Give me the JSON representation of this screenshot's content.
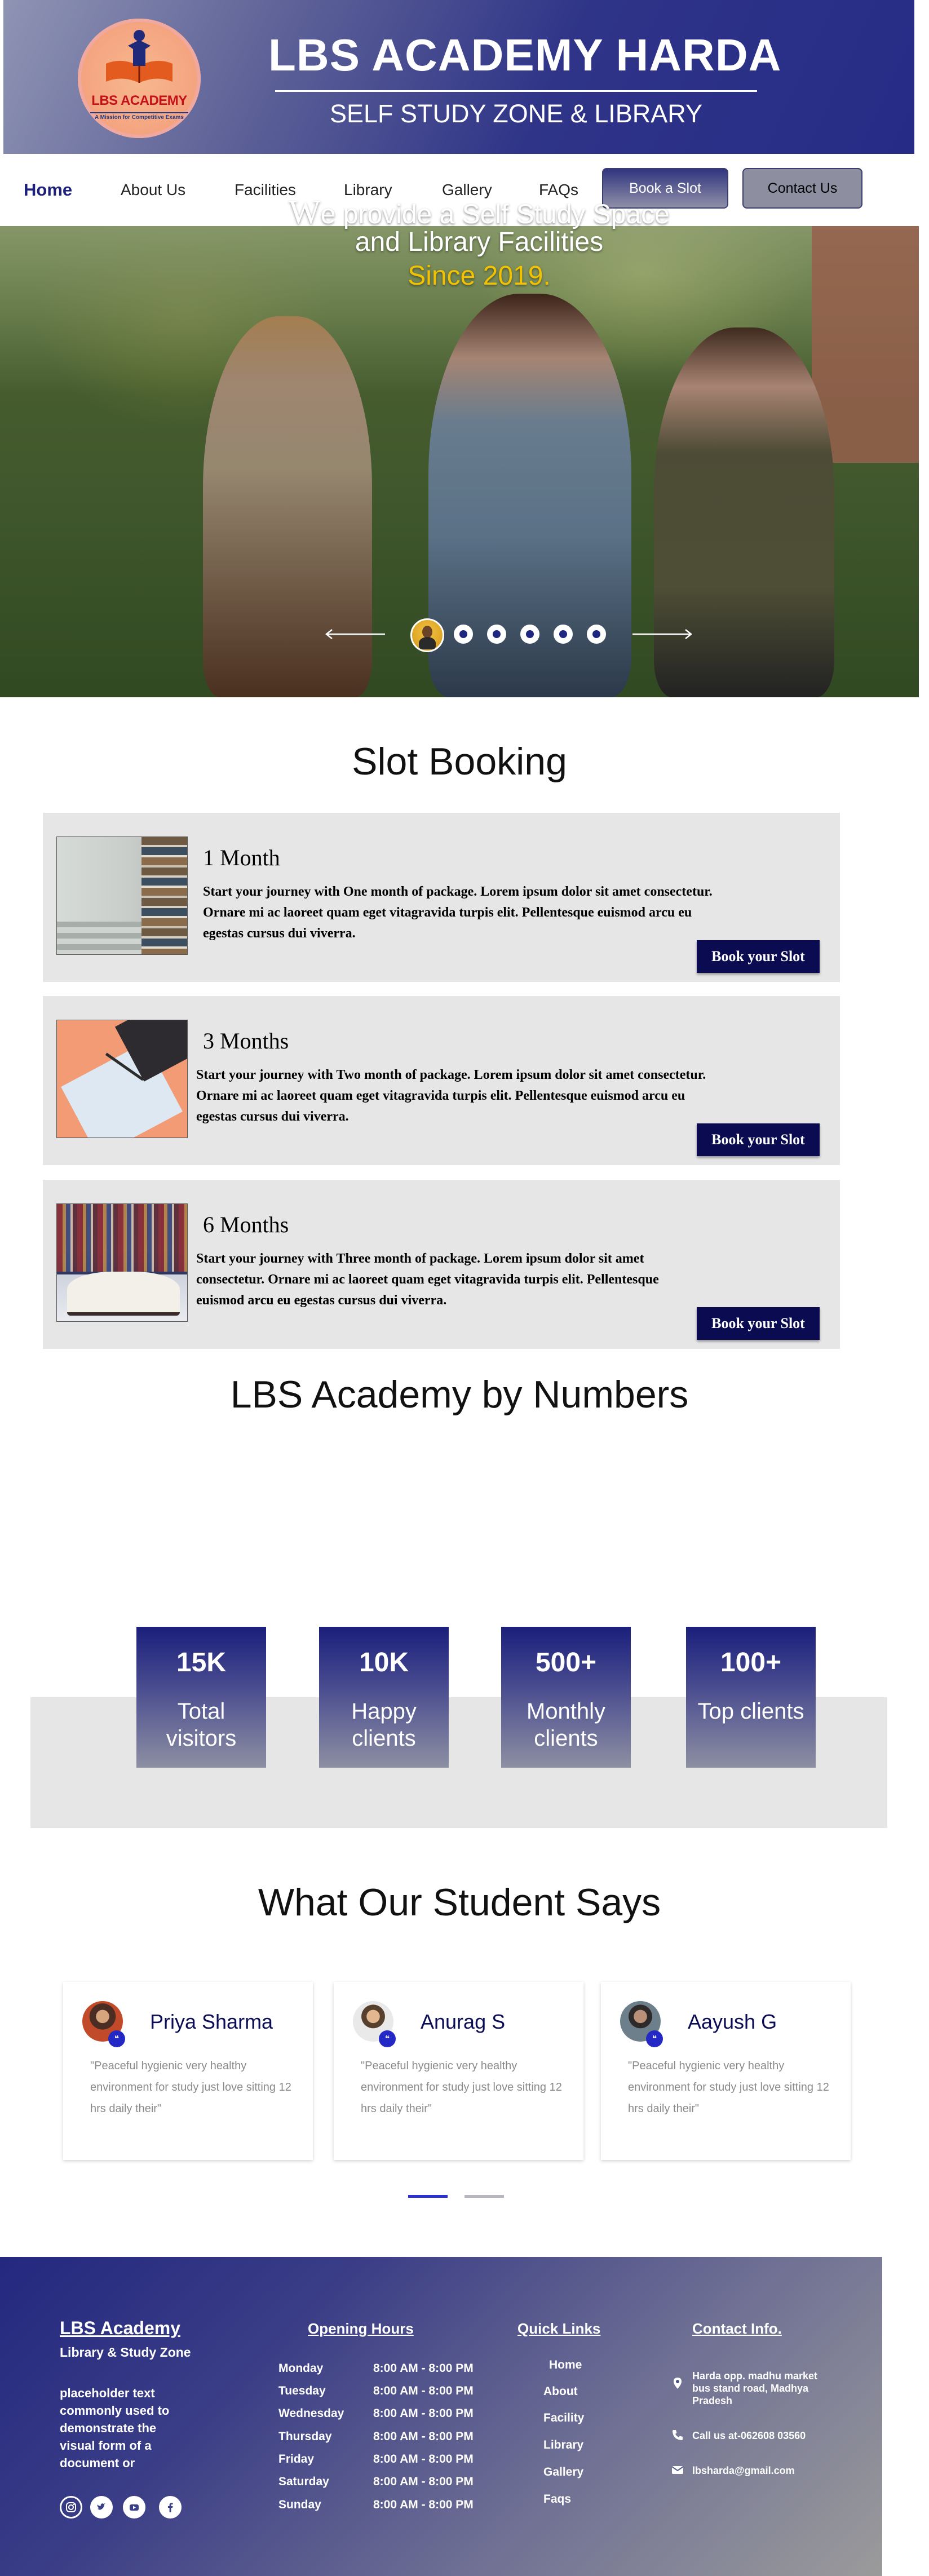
{
  "header": {
    "logo_name": "LBS ACADEMY",
    "logo_tagline": "A Mission for Competitive Exams",
    "title": "LBS ACADEMY HARDA",
    "subtitle": "SELF STUDY ZONE & LIBRARY"
  },
  "nav": {
    "items": [
      "Home",
      "About Us",
      "Facilities",
      "Library",
      "Gallery",
      "FAQs"
    ],
    "book_label": "Book a Slot",
    "contact_label": "Contact Us"
  },
  "hero": {
    "line1_first": "W",
    "line1_rest": "e provide a Self Study Space",
    "line2": "and Library Facilities",
    "line3": "Since 2019."
  },
  "slots": {
    "title": "Slot Booking",
    "cards": [
      {
        "title": "1 Month",
        "desc": "Start your journey with One month of package. Lorem ipsum dolor sit amet consectetur. Ornare mi ac laoreet quam eget vitagravida turpis elit. Pellentesque euismod arcu eu egestas cursus dui viverra.",
        "button": "Book your Slot"
      },
      {
        "title": "3 Months",
        "desc": "Start your journey with Two month of package. Lorem ipsum dolor sit amet consectetur. Ornare mi ac laoreet quam eget vitagravida turpis elit. Pellentesque euismod arcu eu egestas cursus dui viverra.",
        "button": "Book your Slot"
      },
      {
        "title": "6 Months",
        "desc": "Start your journey with Three month of package. Lorem ipsum dolor sit amet consectetur. Ornare mi ac laoreet quam eget vitagravida turpis elit. Pellentesque euismod arcu eu egestas cursus dui viverra.",
        "button": "Book your Slot"
      }
    ]
  },
  "numbers": {
    "title": "LBS Academy by Numbers",
    "stats": [
      {
        "value": "15K",
        "label": "Total visitors"
      },
      {
        "value": "10K",
        "label": "Happy clients"
      },
      {
        "value": "500+",
        "label": "Monthly clients"
      },
      {
        "value": "100+",
        "label": "Top clients"
      }
    ]
  },
  "testimonials": {
    "title": "What Our Student Says",
    "items": [
      {
        "name": "Priya Sharma",
        "quote": "\"Peaceful hygienic very healthy environment for study just love sitting 12 hrs daily their\""
      },
      {
        "name": "Anurag S",
        "quote": "\"Peaceful hygienic very healthy environment for study just love sitting 12 hrs daily their\""
      },
      {
        "name": "Aayush G",
        "quote": "\"Peaceful hygienic very healthy environment for study just love sitting 12 hrs daily their\""
      }
    ],
    "quote_badge": "❝"
  },
  "footer": {
    "brand": "LBS Academy",
    "brand_sub": "Library & Study Zone",
    "desc": "placeholder text commonly used to demonstrate the visual form of a document or",
    "hours_title": "Opening Hours",
    "hours": [
      {
        "day": "Monday",
        "time": "8:00 AM - 8:00 PM"
      },
      {
        "day": "Tuesday",
        "time": "8:00 AM - 8:00 PM"
      },
      {
        "day": "Wednesday",
        "time": "8:00 AM - 8:00 PM"
      },
      {
        "day": "Thursday",
        "time": "8:00 AM - 8:00 PM"
      },
      {
        "day": "Friday",
        "time": "8:00 AM - 8:00 PM"
      },
      {
        "day": "Saturday",
        "time": "8:00 AM - 8:00 PM"
      },
      {
        "day": "Sunday",
        "time": "8:00 AM - 8:00 PM"
      }
    ],
    "links_title": "Quick Links",
    "links": [
      "Home",
      "About",
      "Facility",
      "Library",
      "Gallery",
      "Faqs"
    ],
    "contact_title": "Contact  Info.",
    "address": "Harda opp. madhu market bus stand road, Madhya Pradesh",
    "phone": "Call us at-062608 03560",
    "email": "lbsharda@gmail.com"
  }
}
